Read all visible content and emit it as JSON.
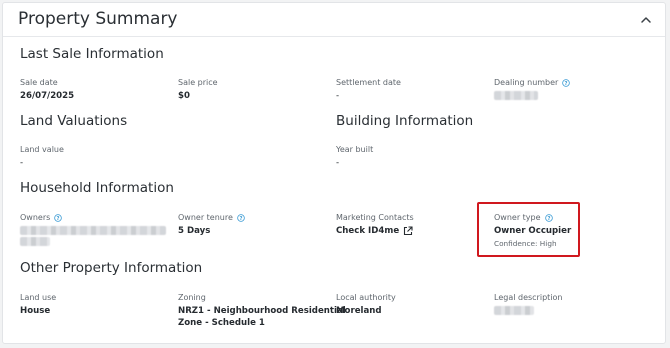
{
  "card": {
    "title": "Property Summary"
  },
  "colors": {
    "info_icon": "#3a9bd4",
    "highlight_border": "#d0181e"
  },
  "icons": {
    "collapse": "chevron-up-icon",
    "info": "info-circle-icon",
    "external": "external-link-icon"
  },
  "last_sale": {
    "title": "Last Sale Information",
    "sale_date": {
      "label": "Sale date",
      "value": "26/07/2025"
    },
    "sale_price": {
      "label": "Sale price",
      "value": "$0"
    },
    "settlement_date": {
      "label": "Settlement date",
      "value": "-"
    },
    "dealing_number": {
      "label": "Dealing number"
    }
  },
  "land_valuations": {
    "title": "Land Valuations",
    "land_value": {
      "label": "Land value",
      "value": "-"
    }
  },
  "building": {
    "title": "Building Information",
    "year_built": {
      "label": "Year built",
      "value": "-"
    }
  },
  "household": {
    "title": "Household Information",
    "owners": {
      "label": "Owners"
    },
    "owner_tenure": {
      "label": "Owner tenure",
      "value": "5 Days"
    },
    "marketing_contacts": {
      "label": "Marketing Contacts",
      "value": "Check ID4me"
    },
    "owner_type": {
      "label": "Owner type",
      "value": "Owner Occupier",
      "confidence": "Confidence: High"
    }
  },
  "other": {
    "title": "Other Property Information",
    "land_use": {
      "label": "Land use",
      "value": "House"
    },
    "zoning": {
      "label": "Zoning",
      "value_line1": "NRZ1 - Neighbourhood Residential",
      "value_line2": "Zone - Schedule 1"
    },
    "local_authority": {
      "label": "Local authority",
      "value": "Moreland"
    },
    "legal_description": {
      "label": "Legal description"
    }
  }
}
